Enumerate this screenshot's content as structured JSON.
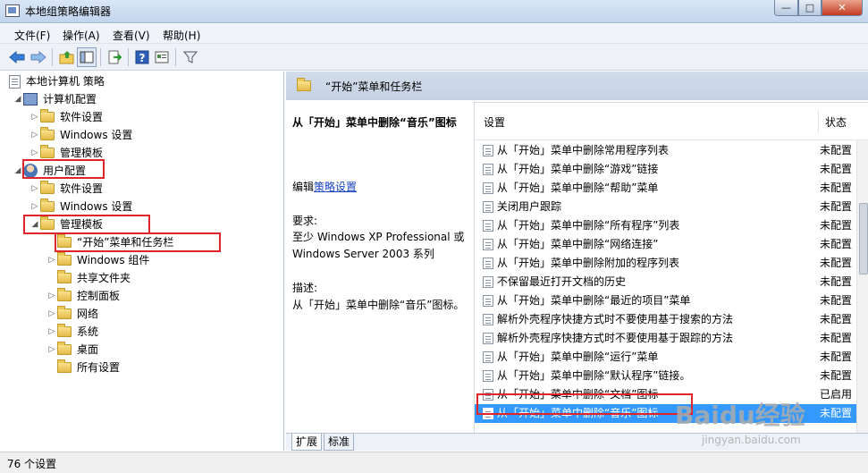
{
  "window": {
    "title": "本地组策略编辑器",
    "min": "—",
    "max": "□",
    "close": "✕"
  },
  "menu": [
    "文件(F)",
    "操作(A)",
    "查看(V)",
    "帮助(H)"
  ],
  "tree": {
    "root": "本地计算机 策略",
    "computer_config": "计算机配置",
    "software_settings_1": "软件设置",
    "windows_settings_1": "Windows 设置",
    "admin_templates_1": "管理模板",
    "user_config": "用户配置",
    "software_settings_2": "软件设置",
    "windows_settings_2": "Windows 设置",
    "admin_templates_2": "管理模板",
    "start_menu": "“开始”菜单和任务栏",
    "windows_components": "Windows 组件",
    "shared_folders": "共享文件夹",
    "control_panel": "控制面板",
    "network": "网络",
    "system": "系统",
    "desktop": "桌面",
    "all_settings": "所有设置"
  },
  "right_header": "“开始”菜单和任务栏",
  "description": {
    "title": "从「开始」菜单中删除“音乐”图标",
    "edit_prefix": "编辑",
    "edit_link": "策略设置",
    "requirement_label": "要求:",
    "requirement_value": "至少 Windows XP Professional 或 Windows Server 2003 系列",
    "desc_label": "描述:",
    "desc_value": "从「开始」菜单中删除“音乐”图标。"
  },
  "list": {
    "col_setting": "设置",
    "col_state": "状态",
    "rows": [
      {
        "setting": "从「开始」菜单中删除常用程序列表",
        "state": "未配置"
      },
      {
        "setting": "从「开始」菜单中删除“游戏”链接",
        "state": "未配置"
      },
      {
        "setting": "从「开始」菜单中删除“帮助”菜单",
        "state": "未配置"
      },
      {
        "setting": "关闭用户跟踪",
        "state": "未配置"
      },
      {
        "setting": "从「开始」菜单中删除“所有程序”列表",
        "state": "未配置"
      },
      {
        "setting": "从「开始」菜单中删除“网络连接”",
        "state": "未配置"
      },
      {
        "setting": "从「开始」菜单中删除附加的程序列表",
        "state": "未配置"
      },
      {
        "setting": "不保留最近打开文档的历史",
        "state": "未配置"
      },
      {
        "setting": "从「开始」菜单中删除“最近的项目”菜单",
        "state": "未配置"
      },
      {
        "setting": "解析外壳程序快捷方式时不要使用基于搜索的方法",
        "state": "未配置"
      },
      {
        "setting": "解析外壳程序快捷方式时不要使用基于跟踪的方法",
        "state": "未配置"
      },
      {
        "setting": "从「开始」菜单中删除“运行”菜单",
        "state": "未配置"
      },
      {
        "setting": "从「开始」菜单中删除“默认程序”链接。",
        "state": "未配置"
      },
      {
        "setting": "从「开始」菜单中删除“文档”图标",
        "state": "已启用"
      },
      {
        "setting": "从「开始」菜单中删除“音乐”图标",
        "state": "未配置"
      }
    ]
  },
  "tabs": [
    "扩展",
    "标准"
  ],
  "status": "76 个设置",
  "watermark": {
    "main": "Baidu经验",
    "sub": "jingyan.baidu.com"
  }
}
